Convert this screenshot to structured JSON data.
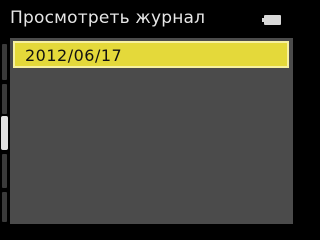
{
  "header": {
    "title": "Просмотреть журнал",
    "battery_icon": "battery-full-icon"
  },
  "list": {
    "items": [
      {
        "label": "2012/06/17",
        "selected": true
      }
    ]
  },
  "colors": {
    "background": "#000000",
    "panel": "#4b4b4b",
    "selection": "#e4d93a",
    "selection_border": "#f6f0a0",
    "title_text": "#e6e6e6",
    "item_text": "#111111",
    "scroll_thumb": "#e0e0e0"
  }
}
